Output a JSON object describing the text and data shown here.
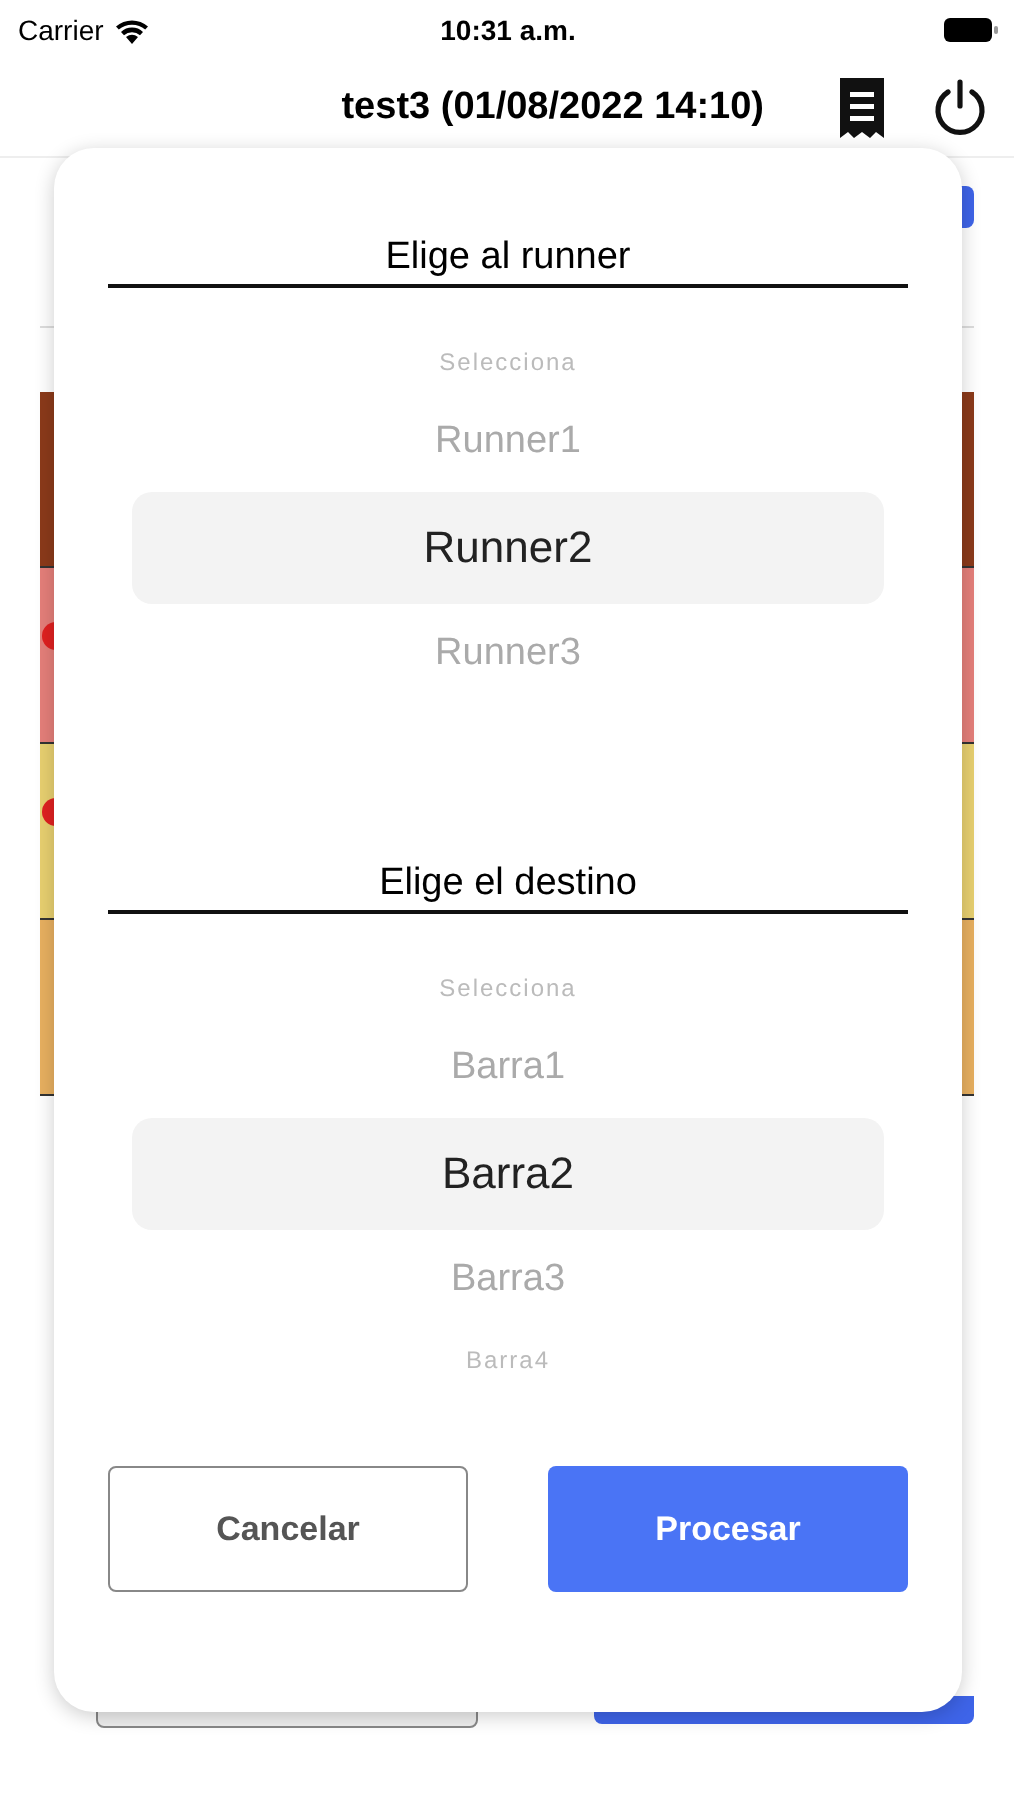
{
  "status_bar": {
    "carrier": "Carrier",
    "time": "10:31 a.m."
  },
  "nav_bar": {
    "title": "test3 (01/08/2022 14:10)"
  },
  "background": {
    "rows": [
      {
        "color": "#8b3a1a",
        "alert": false
      },
      {
        "color": "#e57f7a",
        "alert": true
      },
      {
        "color": "#e8d070",
        "alert": true
      },
      {
        "color": "#e8b060",
        "alert": false
      }
    ]
  },
  "dialog": {
    "pickers": [
      {
        "label": "Elige al runner",
        "options": [
          {
            "text": "Selecciona",
            "selected": false
          },
          {
            "text": "Runner1",
            "selected": false
          },
          {
            "text": "Runner2",
            "selected": true
          },
          {
            "text": "Runner3",
            "selected": false
          }
        ]
      },
      {
        "label": "Elige el destino",
        "options": [
          {
            "text": "Selecciona",
            "selected": false
          },
          {
            "text": "Barra1",
            "selected": false
          },
          {
            "text": "Barra2",
            "selected": true
          },
          {
            "text": "Barra3",
            "selected": false
          },
          {
            "text": "Barra4",
            "selected": false
          }
        ]
      }
    ],
    "buttons": [
      {
        "kind": "secondary",
        "label": "Cancelar"
      },
      {
        "kind": "primary",
        "label": "Procesar"
      }
    ]
  }
}
